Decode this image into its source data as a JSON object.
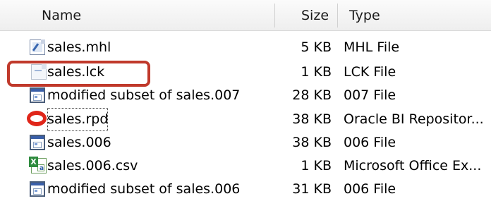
{
  "columns": {
    "name": "Name",
    "size": "Size",
    "type": "Type"
  },
  "files": [
    {
      "name": "sales.mhl",
      "size": "5 KB",
      "type": "MHL File",
      "icon": "mhl-file-icon"
    },
    {
      "name": "sales.lck",
      "size": "1 KB",
      "type": "LCK File",
      "icon": "generic-file-icon"
    },
    {
      "name": "modified subset of sales.007",
      "size": "28 KB",
      "type": "007 File",
      "icon": "window-file-icon"
    },
    {
      "name": "sales.rpd",
      "size": "38 KB",
      "type": "Oracle BI Repositor...",
      "icon": "oracle-icon"
    },
    {
      "name": "sales.006",
      "size": "38 KB",
      "type": "006 File",
      "icon": "window-file-icon"
    },
    {
      "name": "sales.006.csv",
      "size": "1 KB",
      "type": "Microsoft Office Ex...",
      "icon": "excel-file-icon"
    },
    {
      "name": "modified subset of sales.006",
      "size": "31 KB",
      "type": "006 File",
      "icon": "window-file-icon"
    }
  ],
  "colors": {
    "annotation_outline": "#c0392b",
    "oracle_red": "#e0261a"
  }
}
